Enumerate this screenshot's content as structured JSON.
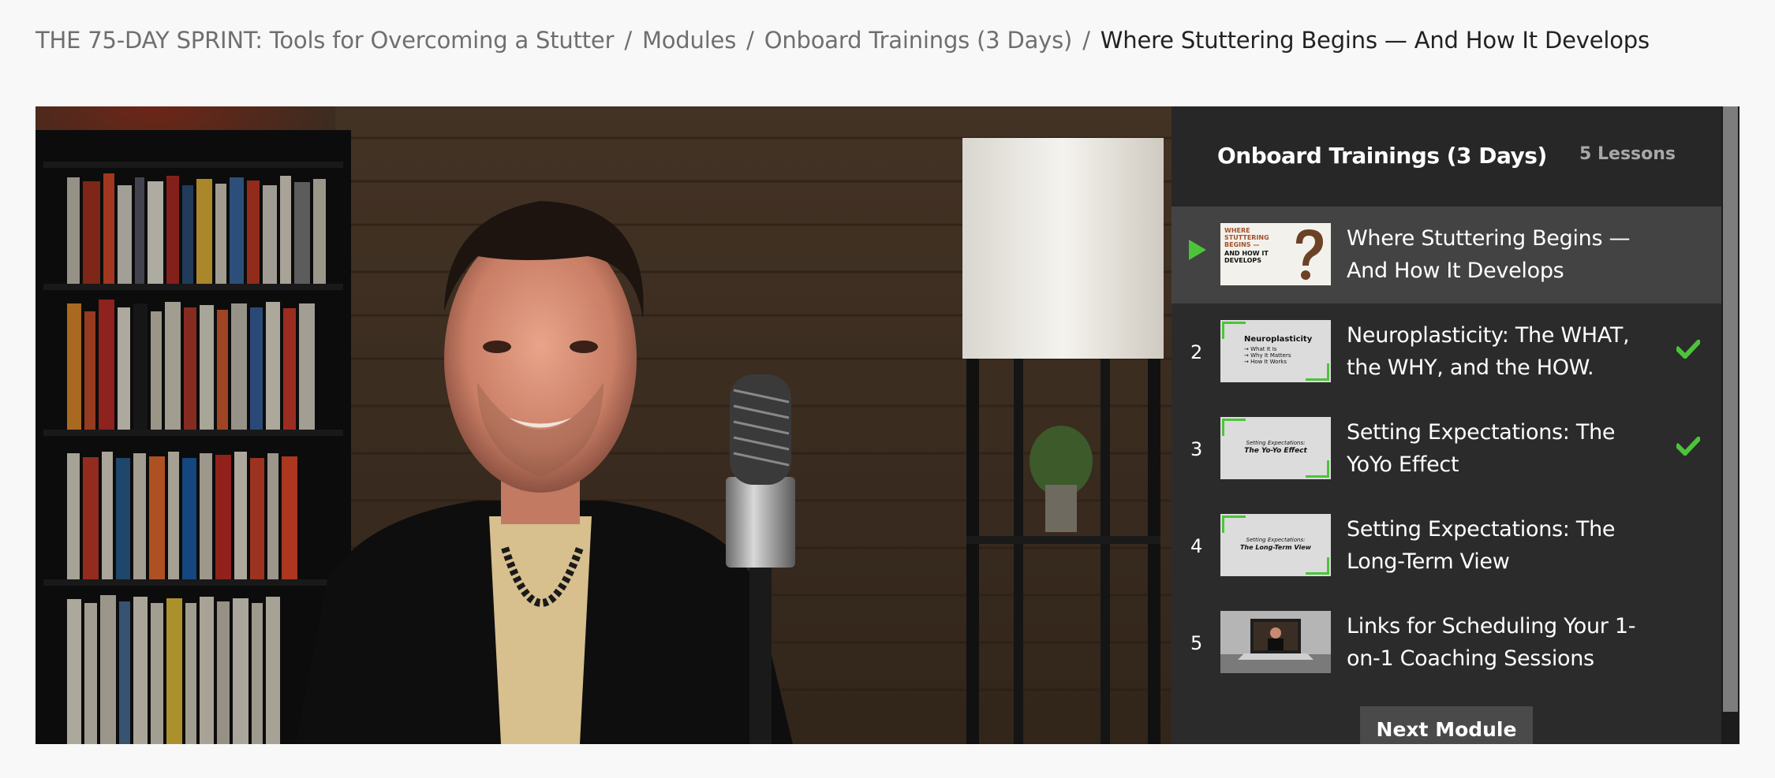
{
  "breadcrumb": {
    "course": "THE 75-DAY SPRINT: Tools for Overcoming a Stutter",
    "modules": "Modules",
    "module": "Onboard Trainings (3 Days)",
    "current": "Where Stuttering Begins — And How It Develops",
    "separator": "/"
  },
  "sidebar": {
    "title": "Onboard Trainings (3 Days)",
    "count": "5 Lessons",
    "lessons": [
      {
        "number": "1",
        "title": "Where Stuttering Begins — And How It Develops",
        "active": true,
        "completed": false,
        "thumb_text": "WHERE STUTTERING BEGINS — AND HOW IT DEVELOPS"
      },
      {
        "number": "2",
        "title": "Neuroplasticity: The WHAT, the WHY, and the HOW.",
        "active": false,
        "completed": true,
        "thumb_text": "Neuroplasticity"
      },
      {
        "number": "3",
        "title": "Setting Expectations: The YoYo Effect",
        "active": false,
        "completed": true,
        "thumb_text": "Setting Expectations: The Yo-Yo Effect"
      },
      {
        "number": "4",
        "title": "Setting Expectations: The Long-Term View",
        "active": false,
        "completed": false,
        "thumb_text": "Setting Expectations: The Long-Term View"
      },
      {
        "number": "5",
        "title": "Links for Scheduling Your 1-on-1 Coaching Sessions",
        "active": false,
        "completed": false,
        "thumb_text": ""
      }
    ],
    "next_button": "Next Module"
  },
  "thumbs": {
    "t1_line1": "WHERE",
    "t1_line2": "STUTTERING",
    "t1_line3": "BEGINS —",
    "t1_line4": "AND HOW IT",
    "t1_line5": "DEVELOPS",
    "t2_title": "Neuroplasticity",
    "t2_b1": "→ What It Is",
    "t2_b2": "→ Why It Matters",
    "t2_b3": "→ How It Works",
    "t3_line1": "Setting Expectations:",
    "t3_line2": "The Yo-Yo Effect",
    "t4_line1": "Setting Expectations:",
    "t4_line2": "The Long-Term View"
  },
  "colors": {
    "accent_green": "#4cc43a",
    "sidebar_bg": "#2b2b2b",
    "active_row": "#434343"
  },
  "icons": {
    "play": "play-icon",
    "check": "checkmark-icon"
  }
}
